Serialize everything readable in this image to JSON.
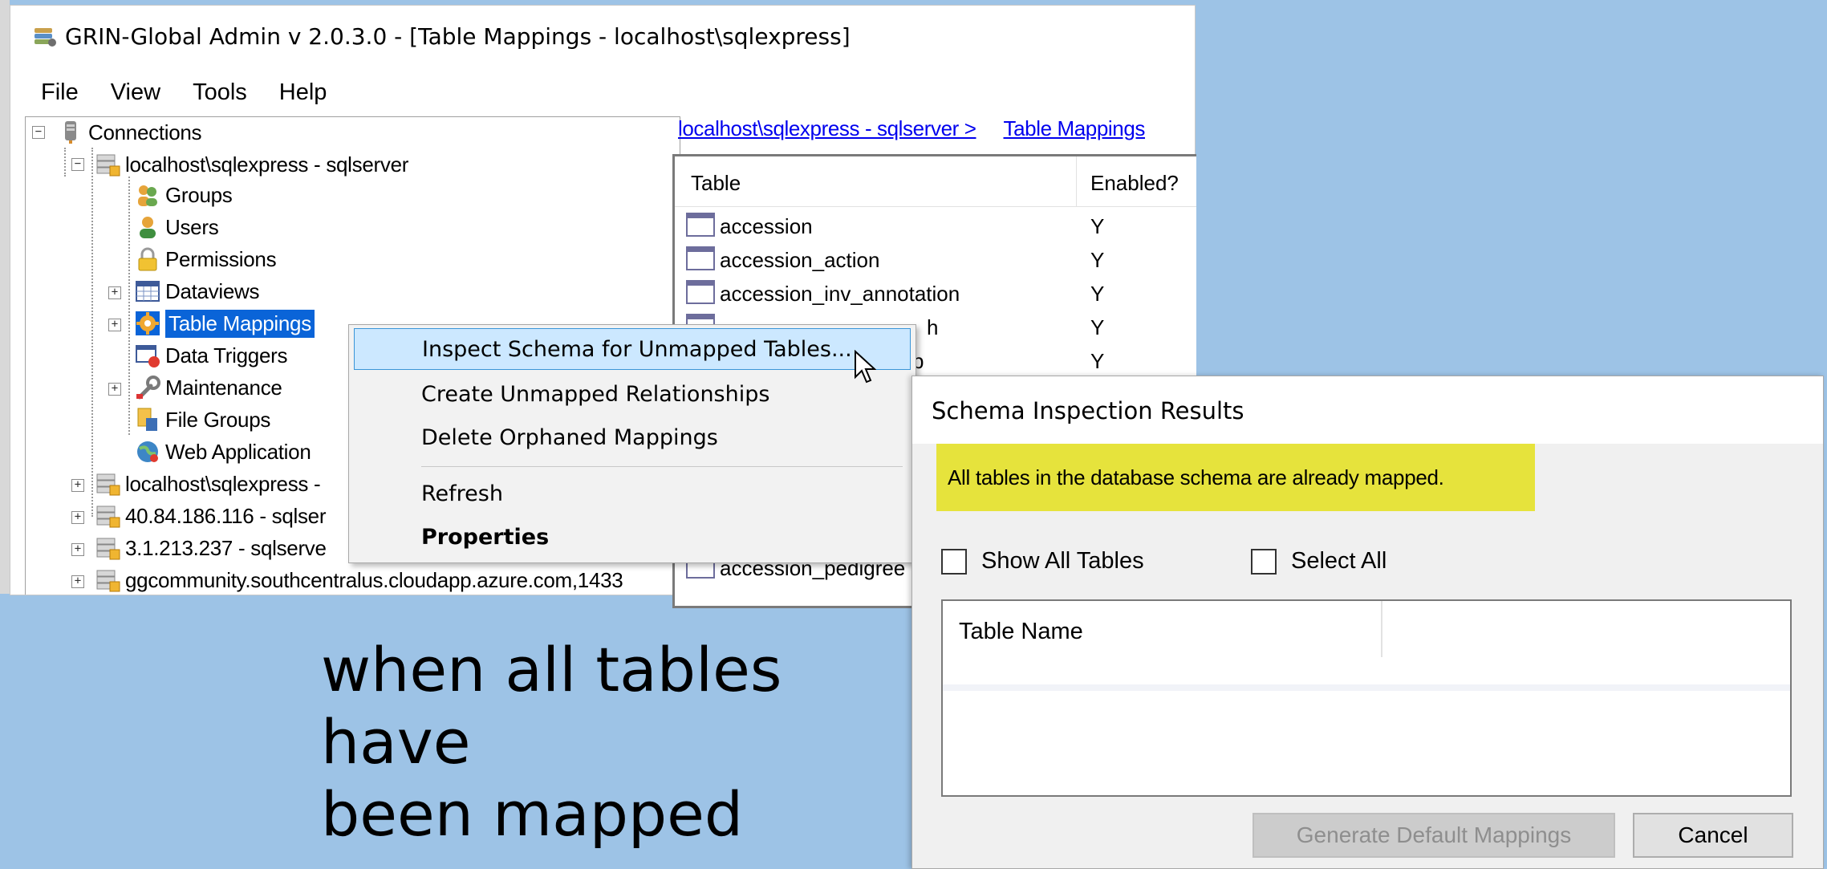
{
  "window": {
    "title": "GRIN-Global Admin v 2.0.3.0 - [Table Mappings - localhost\\sqlexpress]"
  },
  "menu": [
    "File",
    "View",
    "Tools",
    "Help"
  ],
  "tree": {
    "root": "Connections",
    "server": "localhost\\sqlexpress - sqlserver",
    "children": [
      "Groups",
      "Users",
      "Permissions",
      "Dataviews",
      "Table Mappings",
      "Data Triggers",
      "Maintenance",
      "File Groups",
      "Web Application"
    ],
    "other_connections": [
      "localhost\\sqlexpress -",
      "40.84.186.116 - sqlser",
      "3.1.213.237 - sqlserve",
      "ggcommunity.southcentralus.cloudapp.azure.com,1433"
    ]
  },
  "breadcrumb": [
    "localhost\\sqlexpress - sqlserver >",
    "Table Mappings"
  ],
  "table_list": {
    "columns": [
      "Table",
      "Enabled?"
    ],
    "rows": [
      {
        "name": "accession",
        "enabled": "Y"
      },
      {
        "name": "accession_action",
        "enabled": "Y"
      },
      {
        "name": "accession_inv_annotation",
        "enabled": "Y"
      },
      {
        "name": "",
        "enabled": "Y"
      },
      {
        "name": "",
        "enabled": "Y"
      }
    ],
    "partial_rows": [
      "h",
      "p",
      "accession_pedigree"
    ]
  },
  "context_menu": {
    "items": [
      "Inspect Schema for Unmapped Tables...",
      "Create Unmapped Relationships",
      "Delete Orphaned Mappings",
      "Refresh",
      "Properties"
    ]
  },
  "caption": [
    "when all tables have",
    "been mapped"
  ],
  "dialog": {
    "title": "Schema Inspection Results",
    "notice": "All tables in the database schema are already mapped.",
    "show_all_label": "Show All Tables",
    "select_all_label": "Select All",
    "list_header": "Table Name",
    "generate_label": "Generate Default Mappings",
    "cancel_label": "Cancel"
  },
  "colors": {
    "desktop": "#9dc3e6",
    "selection": "#0a64d8",
    "menu_hover": "#cce8ff",
    "notice_highlight": "#e6e33c",
    "link": "#0000ee"
  },
  "icons": [
    "app-icon",
    "database-server-icon",
    "sql-server-icon",
    "groups-icon",
    "user-icon",
    "lock-icon",
    "dataview-grid-icon",
    "gear-icon",
    "trigger-icon",
    "wrench-icon",
    "file-groups-icon",
    "globe-icon",
    "table-icon",
    "mouse-pointer-icon"
  ]
}
